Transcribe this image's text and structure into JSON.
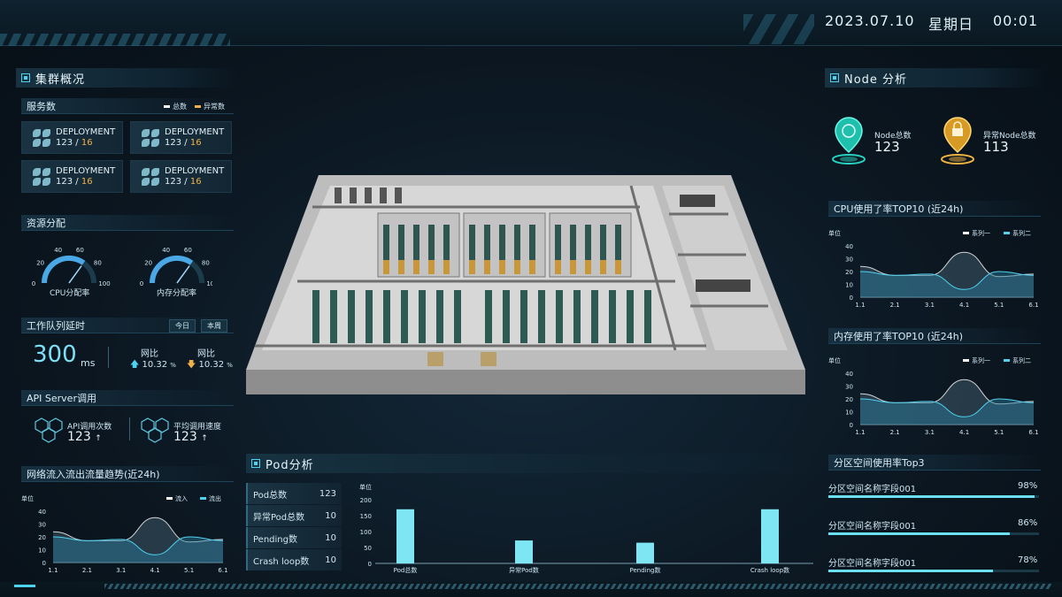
{
  "header": {
    "date": "2023.07.10",
    "weekday": "星期日",
    "time": "00:01"
  },
  "cluster": {
    "title": "集群概况",
    "services": {
      "title": "服务数",
      "legend_total": "总数",
      "legend_abnormal": "异常数",
      "colors": {
        "total": "#ffffff",
        "abnormal": "#f0b04a"
      },
      "cards": [
        {
          "label": "DEPLOYMENT",
          "total": "123",
          "abnormal": "16"
        },
        {
          "label": "DEPLOYMENT",
          "total": "123",
          "abnormal": "16"
        },
        {
          "label": "DEPLOYMENT",
          "total": "123",
          "abnormal": "16"
        },
        {
          "label": "DEPLOYMENT",
          "total": "123",
          "abnormal": "16"
        }
      ]
    },
    "resources": {
      "title": "资源分配",
      "cpu": {
        "label": "CPU分配率",
        "ticks": [
          "0",
          "20",
          "40",
          "60",
          "80",
          "100"
        ],
        "value": 70
      },
      "mem": {
        "label": "内存分配率",
        "ticks": [
          "0",
          "20",
          "40",
          "60",
          "80",
          "100"
        ],
        "value": 70
      }
    },
    "queue": {
      "title": "工作队列延时",
      "btn_today": "今日",
      "btn_week": "本周",
      "value": "300",
      "unit": "ms",
      "up": {
        "label": "网比",
        "value": "10.32",
        "unit": "%"
      },
      "down": {
        "label": "网比",
        "value": "10.32",
        "unit": "%"
      }
    },
    "api": {
      "title": "API Server调用",
      "calls": {
        "label": "API调用次数",
        "value": "123",
        "arrow": "↑"
      },
      "speed": {
        "label": "平均调用速度",
        "value": "123",
        "arrow": "↑"
      }
    },
    "traffic": {
      "title": "网络流入流出流量趋势(近24h)",
      "unit": "单位",
      "legend_in": "流入",
      "legend_out": "流出"
    }
  },
  "node": {
    "title": "Node 分析",
    "total": {
      "label": "Node总数",
      "value": "123"
    },
    "abnormal": {
      "label": "异常Node总数",
      "value": "113"
    },
    "cpu_title": "CPU使用了率TOP10 (近24h)",
    "mem_title": "内存使用了率TOP10 (近24h)",
    "unit": "单位",
    "series1": "系列一",
    "series2": "系列二"
  },
  "partition": {
    "title": "分区空间使用率Top3",
    "items": [
      {
        "name": "分区空间名称字段001",
        "percent": "98%",
        "value": 98
      },
      {
        "name": "分区空间名称字段001",
        "percent": "86%",
        "value": 86
      },
      {
        "name": "分区空间名称字段001",
        "percent": "78%",
        "value": 78
      }
    ]
  },
  "pod": {
    "title": "Pod分析",
    "stats": [
      {
        "label": "Pod总数",
        "value": "123"
      },
      {
        "label": "异常Pod总数",
        "value": "10"
      },
      {
        "label": "Pending数",
        "value": "10"
      },
      {
        "label": "Crash loop数",
        "value": "10"
      }
    ],
    "unit": "单位"
  },
  "chart_data": [
    {
      "type": "area",
      "ylabel": "单位",
      "x": [
        "1.1",
        "2.1",
        "3.1",
        "4.1",
        "5.1",
        "6.1"
      ],
      "ylim": [
        0,
        40
      ],
      "yticks": [
        0,
        10,
        20,
        30,
        40
      ],
      "series": [
        {
          "name": "流入",
          "values": [
            24,
            17,
            17,
            35,
            16,
            18
          ]
        },
        {
          "name": "流出",
          "values": [
            20,
            17,
            18,
            6,
            20,
            17
          ]
        }
      ],
      "legend": "top-right",
      "colors": [
        "#ffffff",
        "#4fd2ee"
      ]
    },
    {
      "type": "area",
      "ylabel": "单位",
      "x": [
        "1.1",
        "2.1",
        "3.1",
        "4.1",
        "5.1",
        "6.1"
      ],
      "ylim": [
        0,
        40
      ],
      "yticks": [
        0,
        10,
        20,
        30,
        40
      ],
      "series": [
        {
          "name": "系列一",
          "values": [
            24,
            17,
            17,
            35,
            16,
            18
          ]
        },
        {
          "name": "系列二",
          "values": [
            20,
            17,
            18,
            6,
            20,
            17
          ]
        }
      ],
      "legend": "top-right",
      "colors": [
        "#ffffff",
        "#4fd2ee"
      ]
    },
    {
      "type": "area",
      "ylabel": "单位",
      "x": [
        "1.1",
        "2.1",
        "3.1",
        "4.1",
        "5.1",
        "6.1"
      ],
      "ylim": [
        0,
        40
      ],
      "yticks": [
        0,
        10,
        20,
        30,
        40
      ],
      "series": [
        {
          "name": "系列一",
          "values": [
            24,
            17,
            17,
            35,
            16,
            18
          ]
        },
        {
          "name": "系列二",
          "values": [
            20,
            17,
            18,
            6,
            20,
            17
          ]
        }
      ],
      "legend": "top-right",
      "colors": [
        "#ffffff",
        "#4fd2ee"
      ]
    },
    {
      "type": "bar",
      "ylabel": "单位",
      "categories": [
        "Pod总数",
        "异常Pod数",
        "Pending数",
        "Crash loop数"
      ],
      "values": [
        170,
        72,
        65,
        170
      ],
      "ylim": [
        0,
        200
      ],
      "yticks": [
        0,
        50,
        100,
        150,
        200
      ],
      "color": "#7ee6f3"
    }
  ]
}
